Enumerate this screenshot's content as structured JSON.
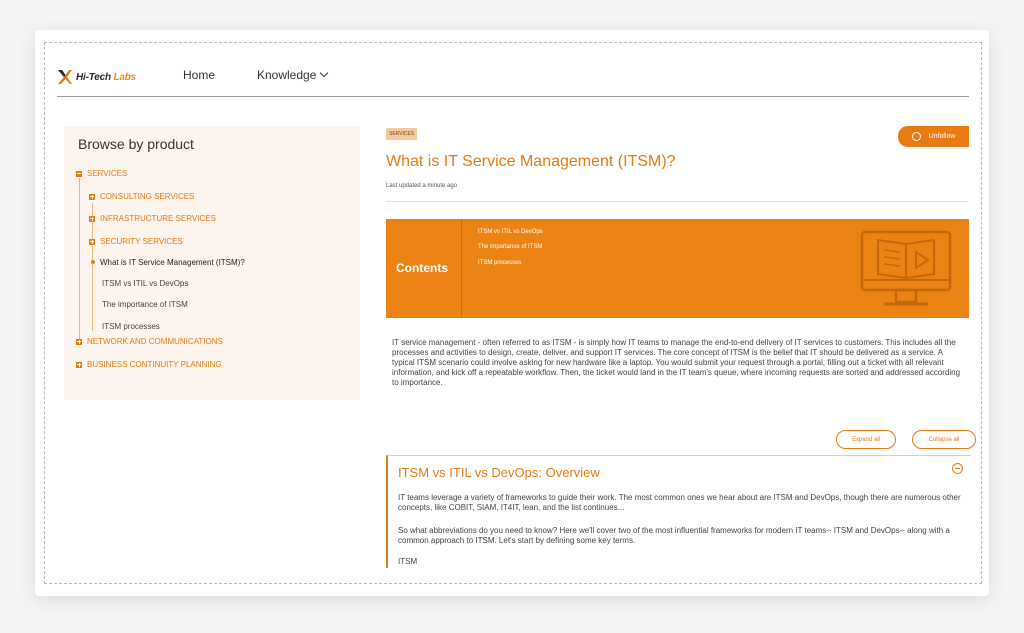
{
  "brand": {
    "name_a": "Hi-Tech",
    "name_b": " Labs",
    "accent": "#e87a12"
  },
  "nav": {
    "home": "Home",
    "knowledge": "Knowledge"
  },
  "sidebar": {
    "title": "Browse by product",
    "services": "SERVICES",
    "consulting": "CONSULTING SERVICES",
    "infrastructure": "INFRASTRUCTURE SERVICES",
    "security": "SECURITY SERVICES",
    "active_article": "What is IT Service Management (ITSM)?",
    "sub1": "ITSM vs ITIL vs DevOps",
    "sub2": "The importance of ITSM",
    "sub3": "ITSM processes",
    "network": "NETWORK AND COMMUNICATIONS",
    "bcp": "BUSINESS CONTINUITY PLANNING"
  },
  "article": {
    "tag": "SERVICES",
    "unfollow": "Unfollow",
    "title": "What is IT Service Management (ITSM)?",
    "updated": "Last updated a minute ago",
    "contents_label": "Contents",
    "contents_links": [
      "ITSM vs ITIL vs DevOps",
      "The importance of ITSM",
      "ITSM processes"
    ],
    "intro": "IT service management - often referred to as ITSM - is simply how IT teams to manage the end-to-end delivery of IT services to customers. This includes all the processes and activities to design, create, deliver, and support IT services. The core concept of ITSM is the belief that IT should be delivered as a service. A typical ITSM scenario could involve asking for new hardware like a laptop. You would submit your request through a portal, filling out a ticket with all relevant information, and kick off a repeatable workflow. Then, the ticket would land in the IT team's queue, where incoming requests are sorted and addressed according to importance.",
    "expand_all": "Expand all",
    "collapse_all": "Collapse all",
    "section_title": "ITSM vs ITIL vs DevOps: Overview",
    "section_p1": "IT teams leverage a variety of frameworks to guide their work. The most common ones we hear about are ITSM and DevOps, though there are numerous other concepts, like COBIT, SIAM, IT4IT, lean, and the list continues...",
    "section_p2": "So what abbreviations do you need to know? Here we'll cover two of the most influential frameworks for modern IT teams-- ITSM and DevOps-- along with a common approach to ITSM. Let's start by defining some key terms.",
    "section_p3": "ITSM"
  }
}
